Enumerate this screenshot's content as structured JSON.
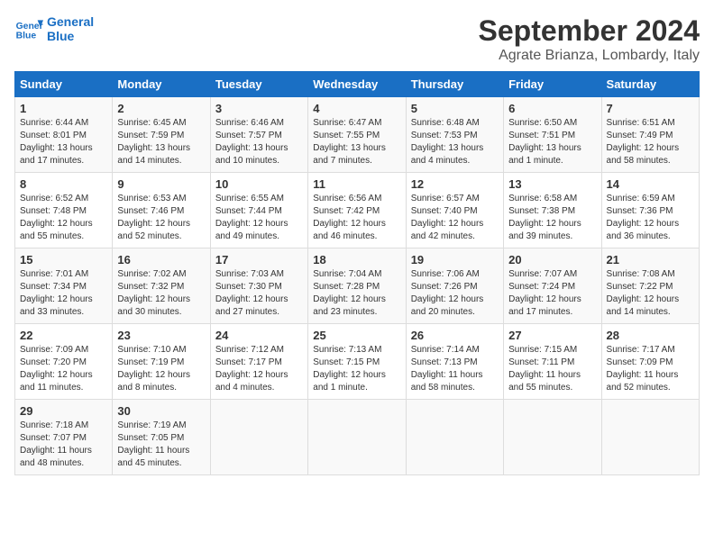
{
  "header": {
    "logo_line1": "General",
    "logo_line2": "Blue",
    "title": "September 2024",
    "subtitle": "Agrate Brianza, Lombardy, Italy"
  },
  "days_of_week": [
    "Sunday",
    "Monday",
    "Tuesday",
    "Wednesday",
    "Thursday",
    "Friday",
    "Saturday"
  ],
  "weeks": [
    [
      {
        "day": "1",
        "info": "Sunrise: 6:44 AM\nSunset: 8:01 PM\nDaylight: 13 hours and 17 minutes."
      },
      {
        "day": "2",
        "info": "Sunrise: 6:45 AM\nSunset: 7:59 PM\nDaylight: 13 hours and 14 minutes."
      },
      {
        "day": "3",
        "info": "Sunrise: 6:46 AM\nSunset: 7:57 PM\nDaylight: 13 hours and 10 minutes."
      },
      {
        "day": "4",
        "info": "Sunrise: 6:47 AM\nSunset: 7:55 PM\nDaylight: 13 hours and 7 minutes."
      },
      {
        "day": "5",
        "info": "Sunrise: 6:48 AM\nSunset: 7:53 PM\nDaylight: 13 hours and 4 minutes."
      },
      {
        "day": "6",
        "info": "Sunrise: 6:50 AM\nSunset: 7:51 PM\nDaylight: 13 hours and 1 minute."
      },
      {
        "day": "7",
        "info": "Sunrise: 6:51 AM\nSunset: 7:49 PM\nDaylight: 12 hours and 58 minutes."
      }
    ],
    [
      {
        "day": "8",
        "info": "Sunrise: 6:52 AM\nSunset: 7:48 PM\nDaylight: 12 hours and 55 minutes."
      },
      {
        "day": "9",
        "info": "Sunrise: 6:53 AM\nSunset: 7:46 PM\nDaylight: 12 hours and 52 minutes."
      },
      {
        "day": "10",
        "info": "Sunrise: 6:55 AM\nSunset: 7:44 PM\nDaylight: 12 hours and 49 minutes."
      },
      {
        "day": "11",
        "info": "Sunrise: 6:56 AM\nSunset: 7:42 PM\nDaylight: 12 hours and 46 minutes."
      },
      {
        "day": "12",
        "info": "Sunrise: 6:57 AM\nSunset: 7:40 PM\nDaylight: 12 hours and 42 minutes."
      },
      {
        "day": "13",
        "info": "Sunrise: 6:58 AM\nSunset: 7:38 PM\nDaylight: 12 hours and 39 minutes."
      },
      {
        "day": "14",
        "info": "Sunrise: 6:59 AM\nSunset: 7:36 PM\nDaylight: 12 hours and 36 minutes."
      }
    ],
    [
      {
        "day": "15",
        "info": "Sunrise: 7:01 AM\nSunset: 7:34 PM\nDaylight: 12 hours and 33 minutes."
      },
      {
        "day": "16",
        "info": "Sunrise: 7:02 AM\nSunset: 7:32 PM\nDaylight: 12 hours and 30 minutes."
      },
      {
        "day": "17",
        "info": "Sunrise: 7:03 AM\nSunset: 7:30 PM\nDaylight: 12 hours and 27 minutes."
      },
      {
        "day": "18",
        "info": "Sunrise: 7:04 AM\nSunset: 7:28 PM\nDaylight: 12 hours and 23 minutes."
      },
      {
        "day": "19",
        "info": "Sunrise: 7:06 AM\nSunset: 7:26 PM\nDaylight: 12 hours and 20 minutes."
      },
      {
        "day": "20",
        "info": "Sunrise: 7:07 AM\nSunset: 7:24 PM\nDaylight: 12 hours and 17 minutes."
      },
      {
        "day": "21",
        "info": "Sunrise: 7:08 AM\nSunset: 7:22 PM\nDaylight: 12 hours and 14 minutes."
      }
    ],
    [
      {
        "day": "22",
        "info": "Sunrise: 7:09 AM\nSunset: 7:20 PM\nDaylight: 12 hours and 11 minutes."
      },
      {
        "day": "23",
        "info": "Sunrise: 7:10 AM\nSunset: 7:19 PM\nDaylight: 12 hours and 8 minutes."
      },
      {
        "day": "24",
        "info": "Sunrise: 7:12 AM\nSunset: 7:17 PM\nDaylight: 12 hours and 4 minutes."
      },
      {
        "day": "25",
        "info": "Sunrise: 7:13 AM\nSunset: 7:15 PM\nDaylight: 12 hours and 1 minute."
      },
      {
        "day": "26",
        "info": "Sunrise: 7:14 AM\nSunset: 7:13 PM\nDaylight: 11 hours and 58 minutes."
      },
      {
        "day": "27",
        "info": "Sunrise: 7:15 AM\nSunset: 7:11 PM\nDaylight: 11 hours and 55 minutes."
      },
      {
        "day": "28",
        "info": "Sunrise: 7:17 AM\nSunset: 7:09 PM\nDaylight: 11 hours and 52 minutes."
      }
    ],
    [
      {
        "day": "29",
        "info": "Sunrise: 7:18 AM\nSunset: 7:07 PM\nDaylight: 11 hours and 48 minutes."
      },
      {
        "day": "30",
        "info": "Sunrise: 7:19 AM\nSunset: 7:05 PM\nDaylight: 11 hours and 45 minutes."
      },
      {
        "day": "",
        "info": ""
      },
      {
        "day": "",
        "info": ""
      },
      {
        "day": "",
        "info": ""
      },
      {
        "day": "",
        "info": ""
      },
      {
        "day": "",
        "info": ""
      }
    ]
  ]
}
